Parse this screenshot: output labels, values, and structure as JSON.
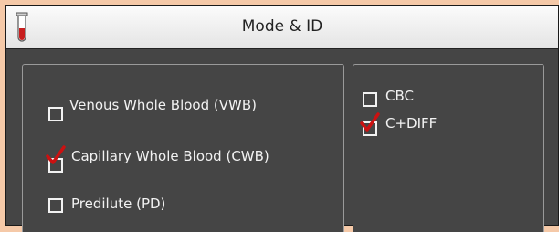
{
  "window": {
    "title": "Mode & ID",
    "title_icon": "test-tube-icon"
  },
  "mode_options": [
    {
      "label": "Venous Whole Blood (VWB)",
      "checked": false
    },
    {
      "label": "Capillary Whole Blood (CWB)",
      "checked": true
    },
    {
      "label": "Predilute (PD)",
      "checked": false
    }
  ],
  "test_options": [
    {
      "label": "CBC",
      "checked": false
    },
    {
      "label": "C+DIFF",
      "checked": true
    }
  ],
  "colors": {
    "check_mark": "#cc1111",
    "panel_bg": "#454545",
    "backdrop": "#f5c9a8"
  }
}
